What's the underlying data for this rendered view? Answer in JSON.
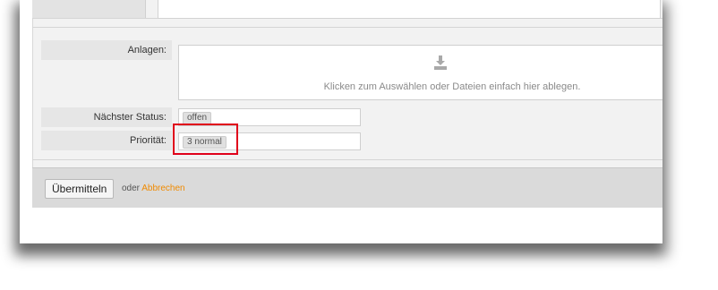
{
  "form": {
    "attachments": {
      "label": "Anlagen:",
      "upload_icon": "download-tray-icon",
      "upload_hint": "Klicken zum Auswählen oder Dateien einfach hier ablegen."
    },
    "next_status": {
      "label": "Nächster Status:",
      "value": "offen"
    },
    "priority": {
      "label": "Priorität:",
      "value": "3 normal"
    },
    "highlight_color": "#e0001a"
  },
  "footer": {
    "submit_label": "Übermitteln",
    "or_text": "oder",
    "cancel_label": "Abbrechen",
    "cancel_color": "#f08a00"
  }
}
